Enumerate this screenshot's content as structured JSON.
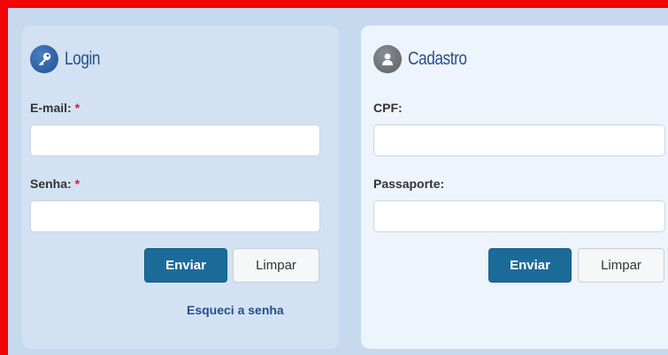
{
  "login": {
    "title": "Login",
    "email_label": "E-mail:",
    "email_required": "*",
    "email_value": "",
    "password_label": "Senha:",
    "password_required": "*",
    "password_value": "",
    "submit_label": "Enviar",
    "clear_label": "Limpar",
    "forgot_link": "Esqueci a senha"
  },
  "cadastro": {
    "title": "Cadastro",
    "cpf_label": "CPF:",
    "cpf_value": "",
    "passport_label": "Passaporte:",
    "passport_value": "",
    "submit_label": "Enviar",
    "clear_label": "Limpar"
  },
  "colors": {
    "frame_border": "#f20505",
    "primary_button": "#1b6b99",
    "heading_text": "#2a4f8c",
    "required_mark": "#e01b1b"
  },
  "icons": {
    "login_icon": "key-icon",
    "cadastro_icon": "user-icon"
  }
}
